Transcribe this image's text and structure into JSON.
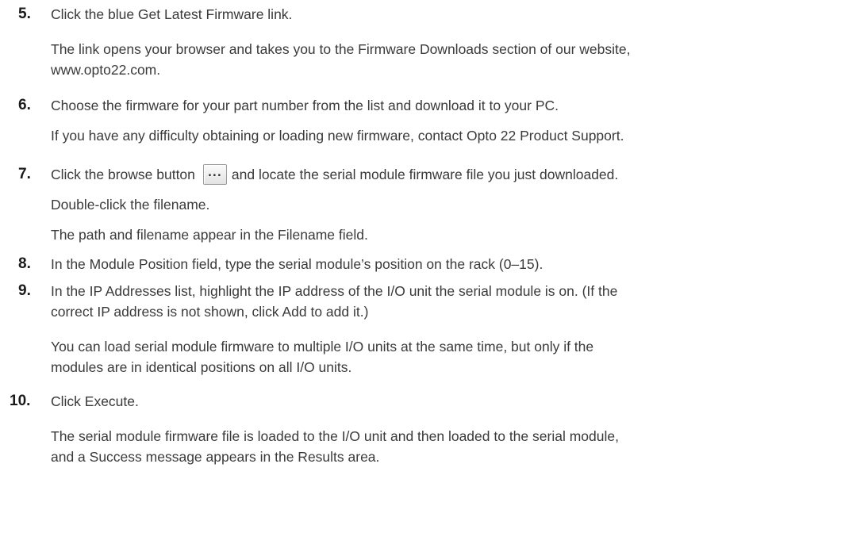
{
  "steps": [
    {
      "number": "5.",
      "lines": [
        "Click the blue Get Latest Firmware link.",
        "The link opens your browser and takes you to the Firmware Downloads section of our website,",
        "www.opto22.com."
      ]
    },
    {
      "number": "6.",
      "lines": [
        "Choose the firmware for your part number from the list and download it to your PC.",
        "If you have any difficulty obtaining or loading new firmware, contact Opto 22 Product Support."
      ]
    },
    {
      "number": "7.",
      "line_before_button": "Click the browse button",
      "button_label": "...",
      "line_after_button": "and locate the serial module firmware file you just downloaded.",
      "lines": [
        "Double-click the filename.",
        "The path and filename appear in the Filename field."
      ]
    },
    {
      "number": "8.",
      "lines": [
        "In the Module Position field, type the serial module’s position on the rack (0–15)."
      ]
    },
    {
      "number": "9.",
      "lines": [
        "In the IP Addresses list, highlight the IP address of the I/O unit the serial module is on. (If the",
        "correct IP address is not shown, click Add to add it.)",
        "You can load serial module firmware to multiple I/O units at the same time, but only if the",
        "modules are in identical positions on all I/O units."
      ]
    },
    {
      "number": "10.",
      "lines": [
        "Click Execute.",
        "The serial module firmware file is loaded to the I/O unit and then loaded to the serial module,",
        "and a Success message appears in the Results area."
      ]
    }
  ]
}
